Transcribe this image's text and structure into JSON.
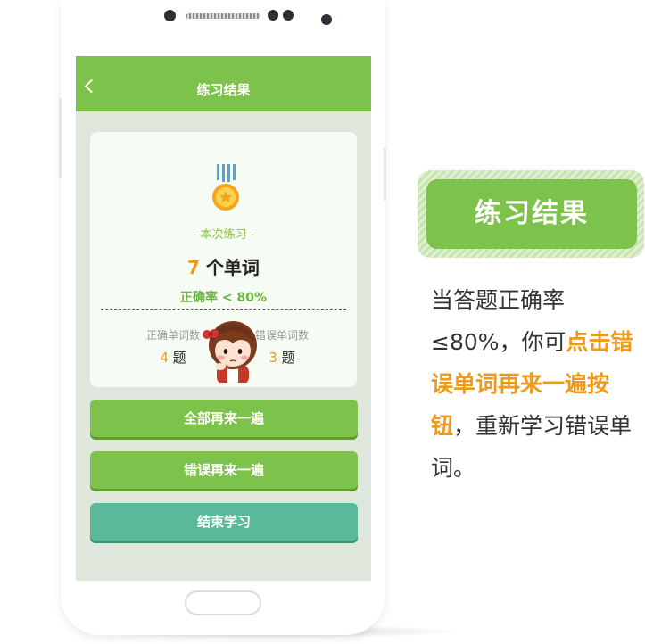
{
  "screen": {
    "title": "练习结果",
    "card": {
      "subtitle": "- 本次练习 -",
      "word_count": "7",
      "word_unit": "个单词",
      "accuracy": "正确率 < 80%",
      "correct": {
        "label": "正确单词数",
        "value": "4",
        "unit": "题"
      },
      "wrong": {
        "label": "错误单词数",
        "value": "3",
        "unit": "题"
      }
    },
    "buttons": {
      "retry_all": "全部再来一遍",
      "retry_wrong": "错误再来一遍",
      "finish": "结束学习"
    }
  },
  "callout": {
    "badge": "练习结果",
    "text_before": "当答题正确率≤80%，你可",
    "text_highlight": "点击错误单词再来一遍按钮",
    "text_after": "，重新学习错误单词。"
  },
  "colors": {
    "accent_green": "#7dc24a",
    "teal": "#58ba98",
    "orange": "#f09a1a"
  },
  "icons": [
    "back-icon",
    "medal-icon",
    "cartoon-girl-image",
    "camera-dot-icon",
    "speaker-grille",
    "home-button"
  ]
}
